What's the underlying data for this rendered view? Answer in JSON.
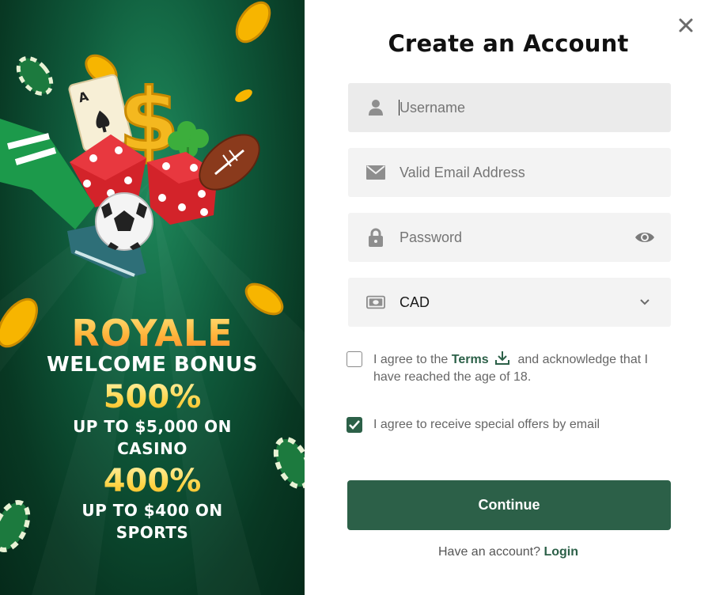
{
  "promo": {
    "headline": "ROYALE",
    "subheadline": "WELCOME BONUS",
    "casino_pct": "500%",
    "casino_offer_line1": "UP TO $5,000 ON",
    "casino_offer_line2": "CASINO",
    "sports_pct": "400%",
    "sports_offer_line1": "UP TO $400 ON",
    "sports_offer_line2": "SPORTS"
  },
  "form": {
    "title": "Create an Account",
    "username_placeholder": "Username",
    "email_placeholder": "Valid Email Address",
    "password_placeholder": "Password",
    "currency_value": "CAD",
    "terms_prefix": "I agree to the",
    "terms_link": "Terms",
    "terms_suffix": "and acknowledge that I have reached the age of 18.",
    "terms_checked": false,
    "offers_label": "I agree to receive special offers by email",
    "offers_checked": true,
    "continue_label": "Continue",
    "have_account_text": "Have an account?",
    "login_link": "Login"
  },
  "icons": {
    "close": "close-icon",
    "username": "user-icon",
    "email": "envelope-icon",
    "password": "lock-icon",
    "show_password": "eye-icon",
    "currency": "banknote-icon",
    "dropdown": "chevron-down-icon",
    "download": "download-icon",
    "check": "checkmark-icon"
  },
  "colors": {
    "brand_green": "#2c6048",
    "promo_gold": "#ffc93c",
    "field_bg": "#f3f3f3"
  }
}
